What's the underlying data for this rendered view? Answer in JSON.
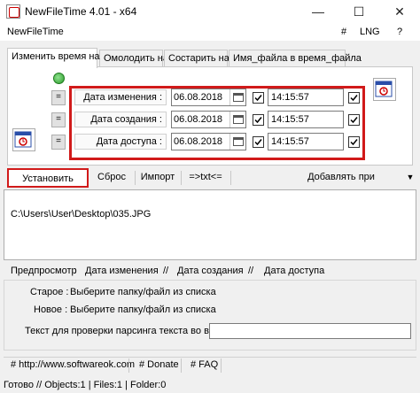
{
  "window": {
    "title": "NewFileTime 4.01 - x64",
    "minimize": "—",
    "maximize": "☐",
    "close": "✕"
  },
  "menu": {
    "app": "NewFileTime",
    "hash": "#",
    "lng": "LNG",
    "help": "?"
  },
  "tabs": [
    {
      "label": "Изменить время на"
    },
    {
      "label": "Омолодить на"
    },
    {
      "label": "Состарить на"
    },
    {
      "label": "Имя_файла в время_файла"
    }
  ],
  "fields": [
    {
      "eq": "=",
      "label": "Дата изменения :",
      "date": "06.08.2018",
      "time": "14:15:57",
      "checked_date": true,
      "checked_time": true
    },
    {
      "eq": "=",
      "label": "Дата создания :",
      "date": "06.08.2018",
      "time": "14:15:57",
      "checked_date": true,
      "checked_time": true
    },
    {
      "eq": "=",
      "label": "Дата доступа :",
      "date": "06.08.2018",
      "time": "14:15:57",
      "checked_date": true,
      "checked_time": true
    }
  ],
  "toolbar": {
    "set_time": "Установить время",
    "reset": "Сброс",
    "import": "Импорт",
    "txt": "=>txt<=",
    "drag_add": "Добавлять при перетягивании:",
    "drag_arrow": "▼"
  },
  "list": {
    "items": [
      "C:\\Users\\User\\Desktop\\035.JPG"
    ]
  },
  "preview": {
    "label": "Предпросмотр",
    "sep": ":",
    "slash": "//",
    "modified": "Дата изменения",
    "created": "Дата создания",
    "accessed": "Дата доступа"
  },
  "status": {
    "old_label": "Старое :",
    "old_value": "Выберите папку/файл из списка",
    "new_label": "Новое :",
    "new_value": "Выберите папку/файл из списка",
    "parse_label": "Текст для проверки парсинга текста во время",
    "parse_value": ""
  },
  "links": {
    "site": "# http://www.softwareok.com",
    "donate": "# Donate",
    "faq": "# FAQ"
  },
  "statusbar": {
    "text": "Готово // Objects:1 | Files:1 | Folder:0"
  },
  "colors": {
    "highlight": "#d11a1a",
    "accent": "#2b9b2b"
  }
}
